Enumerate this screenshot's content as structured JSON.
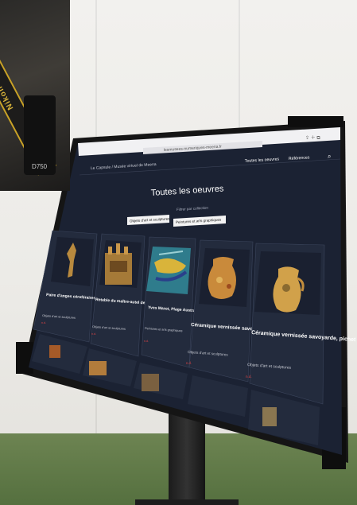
{
  "inset_photo": {
    "strap_brand": "Nikon",
    "strap_suffix": "D750"
  },
  "browser": {
    "url": "lesmusees-numeriques-meena.fr"
  },
  "site": {
    "brand": "Le Capsule / Musée virtuel de Meena",
    "nav": [
      "Toutes les oeuvres",
      "Références"
    ],
    "page_title": "Toutes les oeuvres",
    "filter_label": "Filtrer par collection",
    "filters": [
      "Objets d'art et sculptures",
      "Peintures et arts graphiques"
    ]
  },
  "cards": [
    {
      "title": "Paire d'anges céroféraires, ange gauche",
      "category": "Objets d'art et sculptures",
      "tag": "n.d."
    },
    {
      "title": "Retable du maître-autel de l'église Saint-Martin",
      "category": "Objets d'art et sculptures",
      "tag": "n.d."
    },
    {
      "title": "Yves Marot, Plage Australe",
      "category": "Peintures et arts graphiques",
      "tag": "n.d."
    },
    {
      "title": "Céramique vernissée savoyarde, pot à motif floral",
      "category": "Objets d'art et sculptures",
      "tag": "n.d."
    },
    {
      "title": "Céramique vernissée savoyarde, pichet à motif jaspé",
      "category": "Objets d'art et sculptures",
      "tag": "n.d."
    }
  ],
  "colors": {
    "screen_bg": "#1b2233",
    "accent_red": "#e04545",
    "frame": "#161616"
  }
}
